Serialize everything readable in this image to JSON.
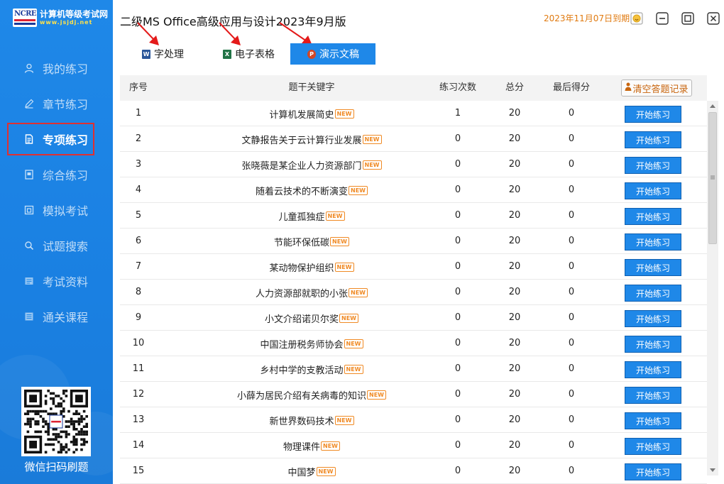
{
  "logo": {
    "mark_text": "NCRE",
    "name": "计算机等级考试网",
    "url": "www.jsjdj.net"
  },
  "sidebar": {
    "items": [
      {
        "label": "我的练习",
        "icon": "user-icon"
      },
      {
        "label": "章节练习",
        "icon": "pencil-icon"
      },
      {
        "label": "专项练习",
        "icon": "document-icon",
        "active": true
      },
      {
        "label": "综合练习",
        "icon": "book-icon"
      },
      {
        "label": "模拟考试",
        "icon": "exam-icon"
      },
      {
        "label": "试题搜索",
        "icon": "search-icon"
      },
      {
        "label": "考试资料",
        "icon": "folder-icon"
      },
      {
        "label": "通关课程",
        "icon": "course-icon"
      }
    ],
    "qr_caption": "微信扫码刷题"
  },
  "header": {
    "title": "二级MS Office高级应用与设计2023年9月版",
    "expire": "2023年11月07日到期"
  },
  "tabs": [
    {
      "label": "字处理",
      "icon": "word-icon",
      "icon_letter": "W",
      "icon_color": "#2b579a"
    },
    {
      "label": "电子表格",
      "icon": "excel-icon",
      "icon_letter": "X",
      "icon_color": "#217346"
    },
    {
      "label": "演示文稿",
      "icon": "powerpoint-icon",
      "icon_letter": "P",
      "icon_color": "#d24726",
      "active": true
    }
  ],
  "table": {
    "headers": {
      "index": "序号",
      "keyword": "题干关键字",
      "count": "练习次数",
      "total": "总分",
      "last": "最后得分"
    },
    "clear_button": "清空答题记录",
    "badge": "NEW",
    "start_label": "开始练习",
    "rows": [
      {
        "index": "1",
        "keyword": "计算机发展简史",
        "count": "1",
        "total": "20",
        "last": "0"
      },
      {
        "index": "2",
        "keyword": "文静报告关于云计算行业发展",
        "count": "0",
        "total": "20",
        "last": "0"
      },
      {
        "index": "3",
        "keyword": "张晓薇是某企业人力资源部门",
        "count": "0",
        "total": "20",
        "last": "0"
      },
      {
        "index": "4",
        "keyword": "随着云技术的不断演变",
        "count": "0",
        "total": "20",
        "last": "0"
      },
      {
        "index": "5",
        "keyword": "儿童孤独症",
        "count": "0",
        "total": "20",
        "last": "0"
      },
      {
        "index": "6",
        "keyword": "节能环保低碳",
        "count": "0",
        "total": "20",
        "last": "0"
      },
      {
        "index": "7",
        "keyword": "某动物保护组织",
        "count": "0",
        "total": "20",
        "last": "0"
      },
      {
        "index": "8",
        "keyword": "人力资源部就职的小张",
        "count": "0",
        "total": "20",
        "last": "0"
      },
      {
        "index": "9",
        "keyword": "小文介绍诺贝尔奖",
        "count": "0",
        "total": "20",
        "last": "0"
      },
      {
        "index": "10",
        "keyword": "中国注册税务师协会",
        "count": "0",
        "total": "20",
        "last": "0"
      },
      {
        "index": "11",
        "keyword": "乡村中学的支教活动",
        "count": "0",
        "total": "20",
        "last": "0"
      },
      {
        "index": "12",
        "keyword": "小薛为居民介绍有关病毒的知识",
        "count": "0",
        "total": "20",
        "last": "0"
      },
      {
        "index": "13",
        "keyword": "新世界数码技术",
        "count": "0",
        "total": "20",
        "last": "0"
      },
      {
        "index": "14",
        "keyword": "物理课件",
        "count": "0",
        "total": "20",
        "last": "0"
      },
      {
        "index": "15",
        "keyword": "中国梦",
        "count": "0",
        "total": "20",
        "last": "0"
      }
    ]
  },
  "colors": {
    "sidebar": "#1f88e8",
    "accent": "#1f88e8",
    "badge": "#f08a24",
    "expire": "#e07a10",
    "highlight": "#e03030"
  }
}
